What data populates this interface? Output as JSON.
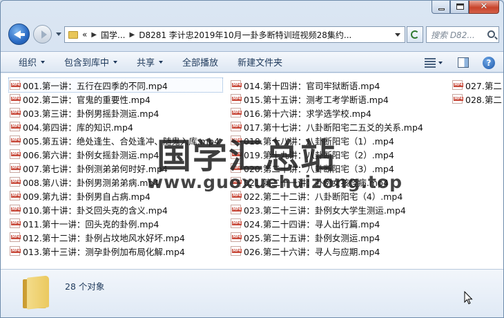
{
  "address": {
    "crumbs": [
      "«",
      "国学...",
      "D8281 李计忠2019年10月一卦多断特训班视频28集约..."
    ]
  },
  "search": {
    "placeholder": "搜索 D82..."
  },
  "toolbar": {
    "items": [
      "组织",
      "包含到库中",
      "共享",
      "全部播放",
      "新建文件夹"
    ]
  },
  "files": {
    "col1": [
      "001.第一讲：五行在四季的不同.mp4",
      "002.第二讲：官鬼的重要性.mp4",
      "003.第三讲：卦例男摇卦测运.mp4",
      "004.第四讲：库的知识.mp4",
      "005.第五讲：绝处逢生、合处逢冲、随鬼入库.mp4",
      "006.第六讲：卦例女摇卦测运.mp4",
      "007.第七讲：卦例测弟弟何时好.mp4",
      "008.第八讲：卦例男测弟弟病.mp4",
      "009.第九讲：卦例男自占病.mp4",
      "010.第十讲：卦爻回头克的含义.mp4",
      "011.第十一讲：回头克的卦例.mp4",
      "012.第十二讲：卦例占坟地风水好坏.mp4",
      "013.第十三讲：测孕卦例加布局化解.mp4"
    ],
    "col2": [
      "014.第十四讲：官司牢狱断语.mp4",
      "015.第十五讲：测考工考学断语.mp4",
      "016.第十六讲：求学选学校.mp4",
      "017.第十七讲：八卦断阳宅二五爻的关系.mp4",
      "018.第十八讲：八卦断阳宅（1）.mp4",
      "019.第十九讲：八卦断阳宅（2）.mp4",
      "020.第二十讲：八卦断阳宅（3）.mp4",
      "021.第二十一讲：卦例女孩怪病.mp4",
      "022.第二十二讲：八卦断阳宅（4）.mp4",
      "023.第二十三讲：卦例女大学生测运.mp4",
      "024.第二十四讲：寻人出行篇.mp4",
      "025.第二十五讲：卦例女测运.mp4",
      "026.第二十六讲：寻人与应期.mp4"
    ],
    "col3": [
      "027.第二",
      "028.第二"
    ]
  },
  "watermark": {
    "title": "国学汇总站",
    "url": "www.guoxuehuizong.top"
  },
  "details": {
    "count": "28 个对象"
  }
}
